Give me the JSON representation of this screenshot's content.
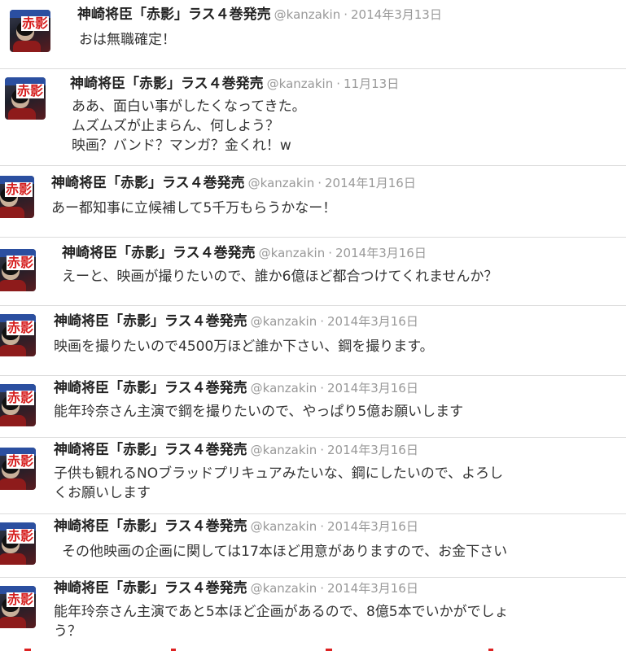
{
  "account": {
    "name": "神崎将臣「赤影」ラス４巻発売",
    "handle": "@kanzakin",
    "avatar_kanji": "赤影"
  },
  "tweets": [
    {
      "date": "2014年3月13日",
      "text": "おは無職確定！"
    },
    {
      "date": "11月13日",
      "text": "ああ、面白い事がしたくなってきた。\nムズムズが止まらん、何しよう？\n映画？バンド？マンガ？金くれ！w"
    },
    {
      "date": "2014年1月16日",
      "text": "あー都知事に立候補して5千万もらうかなー！"
    },
    {
      "date": "2014年3月16日",
      "text": "えーと、映画が撮りたいので、誰か6億ほど都合つけてくれませんか？"
    },
    {
      "date": "2014年3月16日",
      "text": "映画を撮りたいので4500万ほど誰か下さい、鋼を撮ります。"
    },
    {
      "date": "2014年3月16日",
      "text": "能年玲奈さん主演で鋼を撮りたいので、やっぱり5億お願いします"
    },
    {
      "date": "2014年3月16日",
      "text": "子供も観れるNOブラッドプリキュアみたいな、鋼にしたいので、よろし\nくお願いします"
    },
    {
      "date": "2014年3月16日",
      "text": "その他映画の企画に関しては17本ほど用意がありますので、お金下さい"
    },
    {
      "date": "2014年3月16日",
      "text": "能年玲奈さん主演であと5本ほど企画があるので、8億5本でいかがでしょ\nう？"
    }
  ]
}
